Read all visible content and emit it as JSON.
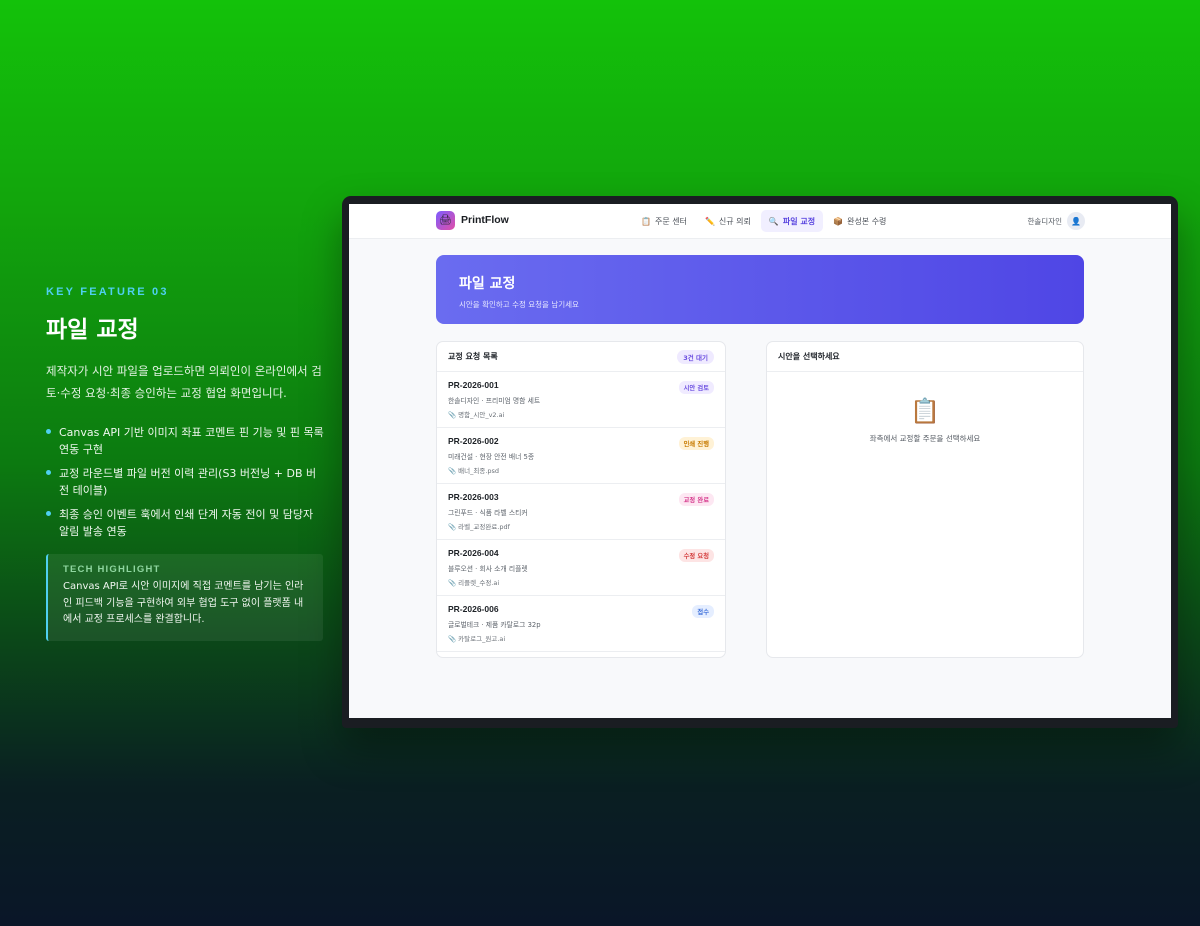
{
  "feature": {
    "kicker": "KEY FEATURE 03",
    "title": "파일 교정",
    "description": "제작자가 시안 파일을 업로드하면 의뢰인이 온라인에서 검토·수정 요청·최종 승인하는 교정 협업 화면입니다.",
    "bullets": [
      "Canvas API 기반 이미지 좌표 코멘트 핀 기능 및 핀 목록 연동 구현",
      "교정 라운드별 파일 버전 이력 관리(S3 버전닝 + DB 버전 테이블)",
      "최종 승인 이벤트 훅에서 인쇄 단계 자동 전이 및 담당자 알림 발송 연동"
    ],
    "tech_title": "TECH HIGHLIGHT",
    "tech_body": "Canvas API로 시안 이미지에 직접 코멘트를 남기는 인라인 피드백 기능을 구현하여 외부 협업 도구 없이 플랫폼 내에서 교정 프로세스를 완결합니다."
  },
  "app": {
    "brand": "PrintFlow",
    "nav": [
      {
        "icon": "📋",
        "label": "주문 센터",
        "active": false
      },
      {
        "icon": "✏️",
        "label": "신규 의뢰",
        "active": false
      },
      {
        "icon": "🔍",
        "label": "파일 교정",
        "active": true
      },
      {
        "icon": "📦",
        "label": "완성본 수령",
        "active": false
      }
    ],
    "user": "한솔디자인",
    "hero_title": "파일 교정",
    "hero_subtitle": "시안을 확인하고 수정 요청을 남기세요",
    "list_title": "교정 요청 목록",
    "list_badge": "3건 대기",
    "items": [
      {
        "id": "PR-2026-001",
        "desc": "한솔디자인 · 프리미엄 명함 세트",
        "file": "📎 명함_시안_v2.ai",
        "status": "시안 검토"
      },
      {
        "id": "PR-2026-002",
        "desc": "미래건설 · 현장 안전 배너 5종",
        "file": "📎 배너_최종.psd",
        "status": "인쇄 진행"
      },
      {
        "id": "PR-2026-003",
        "desc": "그린푸드 · 식품 라벨 스티커",
        "file": "📎 라벨_교정완료.pdf",
        "status": "교정 완료"
      },
      {
        "id": "PR-2026-004",
        "desc": "블루오션 · 회사 소개 리플렛",
        "file": "📎 리플렛_수정.ai",
        "status": "수정 요청"
      },
      {
        "id": "PR-2026-006",
        "desc": "글로벌테크 · 제품 카탈로그 32p",
        "file": "📎 카탈로그_원고.ai",
        "status": "접수"
      }
    ],
    "detail_title": "시안을 선택하세요",
    "detail_empty_icon": "📋",
    "detail_empty_text": "좌측에서 교정할 주문을 선택하세요"
  }
}
